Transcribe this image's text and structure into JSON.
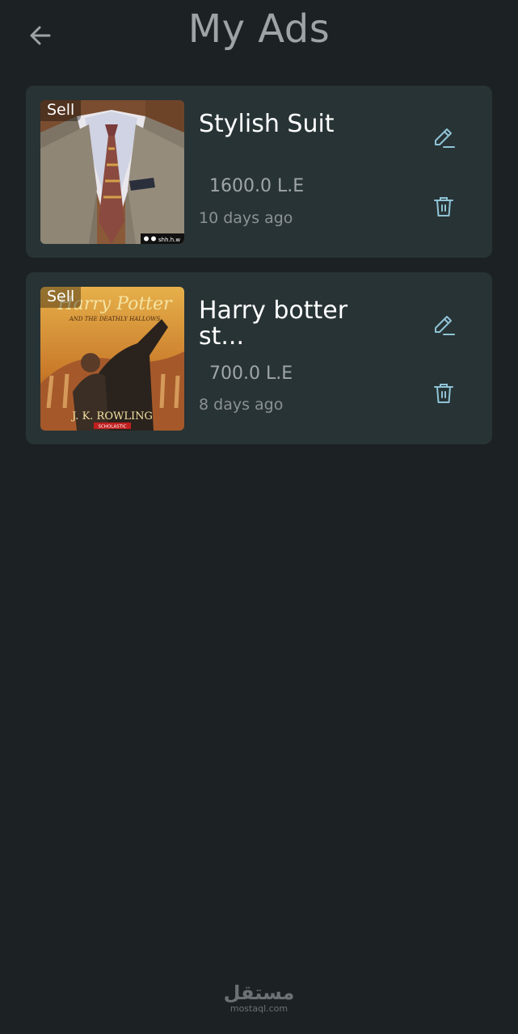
{
  "header": {
    "title": "My Ads",
    "back_icon": "arrow-left-icon"
  },
  "ads": [
    {
      "badge": "Sell",
      "title": "Stylish Suit",
      "price": "1600.0 L.E",
      "time": "10 days ago",
      "image_caption": "shh.h.w",
      "edit_icon": "pencil-icon",
      "delete_icon": "trash-icon"
    },
    {
      "badge": "Sell",
      "title": "Harry botter st...",
      "price": "700.0 L.E",
      "time": "8 days ago",
      "book_title": "Harry Potter",
      "book_subtitle": "AND THE DEATHLY HALLOWS",
      "book_author": "J. K. ROWLING",
      "book_publisher": "SCHOLASTIC",
      "edit_icon": "pencil-icon",
      "delete_icon": "trash-icon"
    }
  ],
  "watermark": {
    "logo": "مستقل",
    "url": "mostaql.com"
  },
  "colors": {
    "background": "#1c2124",
    "card": "#283335",
    "icon_accent": "#8fc3d6",
    "title": "#9ea3a6"
  }
}
